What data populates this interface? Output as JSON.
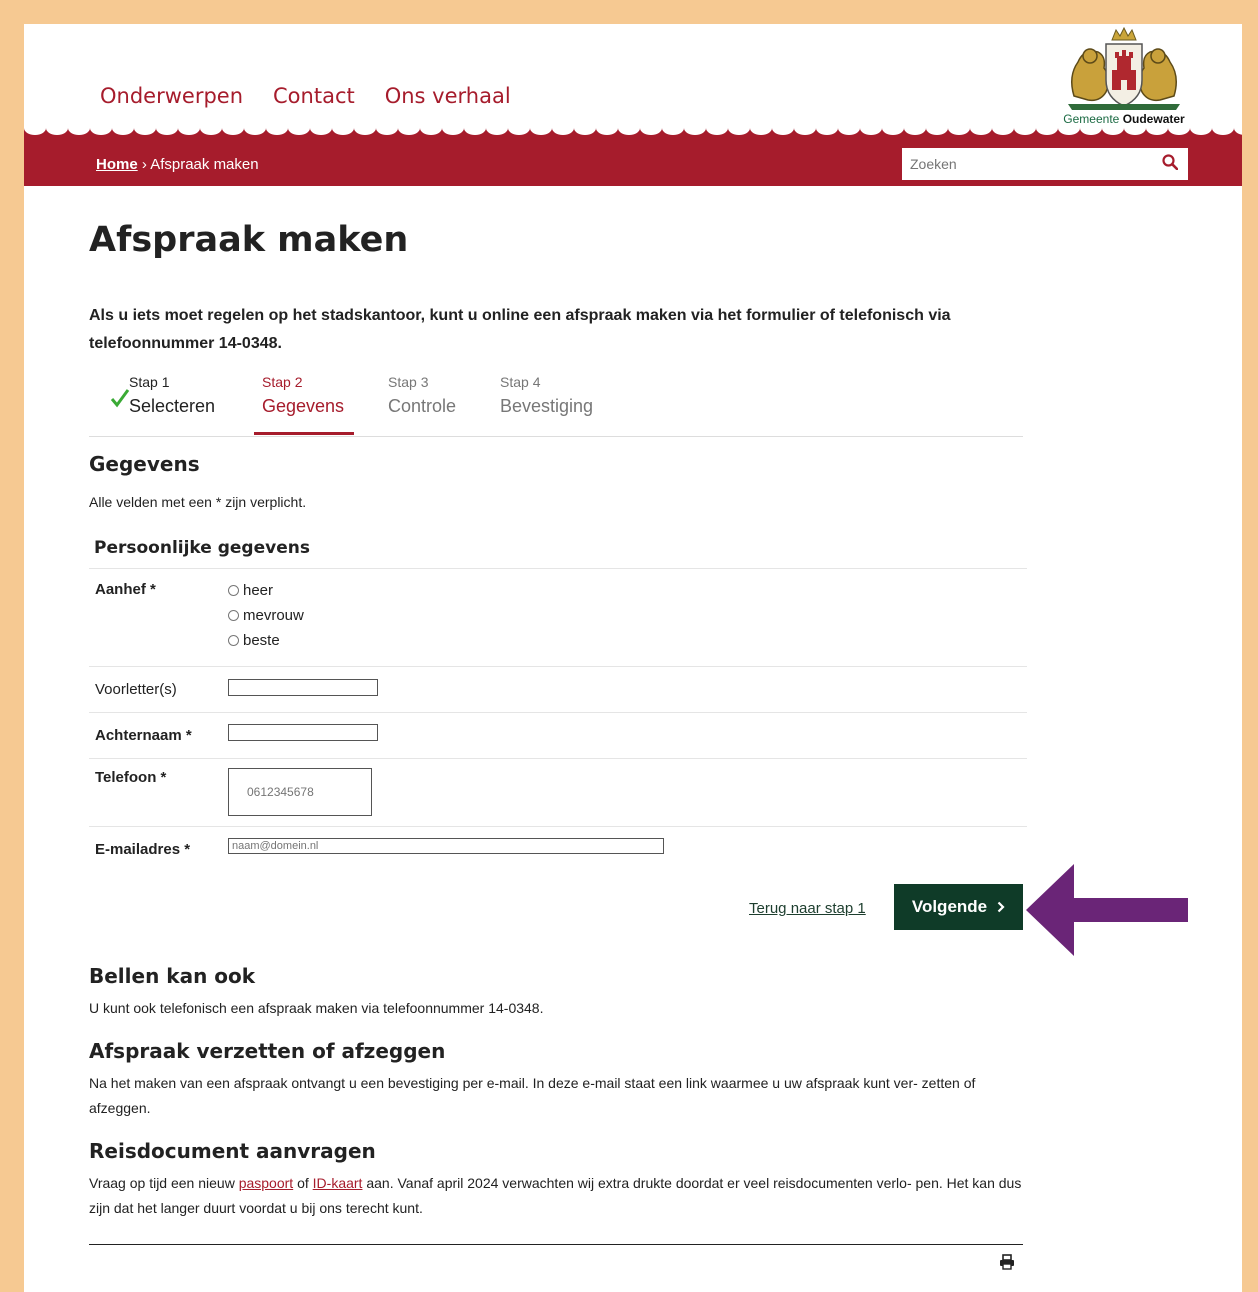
{
  "nav": {
    "items": [
      "Onderwerpen",
      "Contact",
      "Ons verhaal"
    ]
  },
  "logo": {
    "prefix": "Gemeente",
    "name": "Oudewater"
  },
  "breadcrumb": {
    "home": "Home",
    "separator": "›",
    "current": "Afspraak maken"
  },
  "search": {
    "placeholder": "Zoeken"
  },
  "page": {
    "title": "Afspraak maken",
    "intro": "Als u iets moet regelen op het stadskantoor, kunt u online een afspraak maken via het formulier of telefonisch via telefoonnummer 14-0348."
  },
  "steps": [
    {
      "num": "Stap 1",
      "label": "Selecteren",
      "state": "done"
    },
    {
      "num": "Stap 2",
      "label": "Gegevens",
      "state": "active"
    },
    {
      "num": "Stap 3",
      "label": "Controle",
      "state": "pending"
    },
    {
      "num": "Stap 4",
      "label": "Bevestiging",
      "state": "pending"
    }
  ],
  "form": {
    "heading": "Gegevens",
    "required_note": "Alle velden met een * zijn verplicht.",
    "section_title": "Persoonlijke gegevens",
    "aanhef_label": "Aanhef *",
    "aanhef_options": [
      "heer",
      "mevrouw",
      "beste"
    ],
    "voorletters_label": "Voorletter(s)",
    "achternaam_label": "Achternaam *",
    "telefoon_label": "Telefoon *",
    "telefoon_placeholder": "0612345678",
    "email_label": "E-mailadres *",
    "email_placeholder": "naam@domein.nl"
  },
  "actions": {
    "back": "Terug naar stap 1",
    "next": "Volgende",
    "next_icon": "chevron-right-icon"
  },
  "sections": {
    "bellen_title": "Bellen kan ook",
    "bellen_text": "U kunt ook telefonisch een afspraak maken via telefoonnummer 14-0348.",
    "verzetten_title": "Afspraak verzetten of afzeggen",
    "verzetten_text": "Na het maken van een afspraak ontvangt u een bevestiging per e-mail. In deze e-mail staat een link waarmee u uw afspraak kunt ver- zetten of afzeggen.",
    "reis_title": "Reisdocument aanvragen",
    "reis_text_1": "Vraag op tijd een nieuw ",
    "reis_link_1": "paspoort",
    "reis_text_2": " of ",
    "reis_link_2": "ID-kaart",
    "reis_text_3": " aan. Vanaf april 2024 verwachten wij extra drukte doordat er veel reisdocumenten verlo- pen. Het kan dus zijn dat het langer duurt voordat u bij ons terecht kunt."
  },
  "colors": {
    "brand_red": "#a61c2c",
    "button_green": "#0f3b28",
    "frame": "#f6c992",
    "arrow_purple": "#6a2577"
  }
}
